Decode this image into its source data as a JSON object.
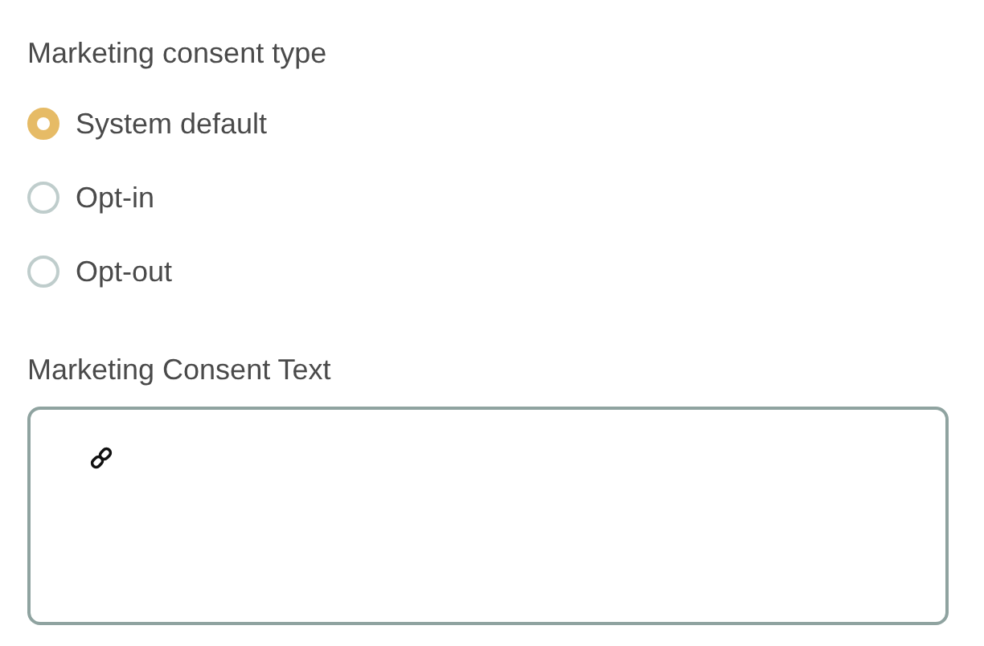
{
  "consent_type": {
    "label": "Marketing consent type",
    "options": [
      {
        "label": "System default",
        "selected": true
      },
      {
        "label": "Opt-in",
        "selected": false
      },
      {
        "label": "Opt-out",
        "selected": false
      }
    ]
  },
  "consent_text": {
    "label": "Marketing Consent Text"
  }
}
